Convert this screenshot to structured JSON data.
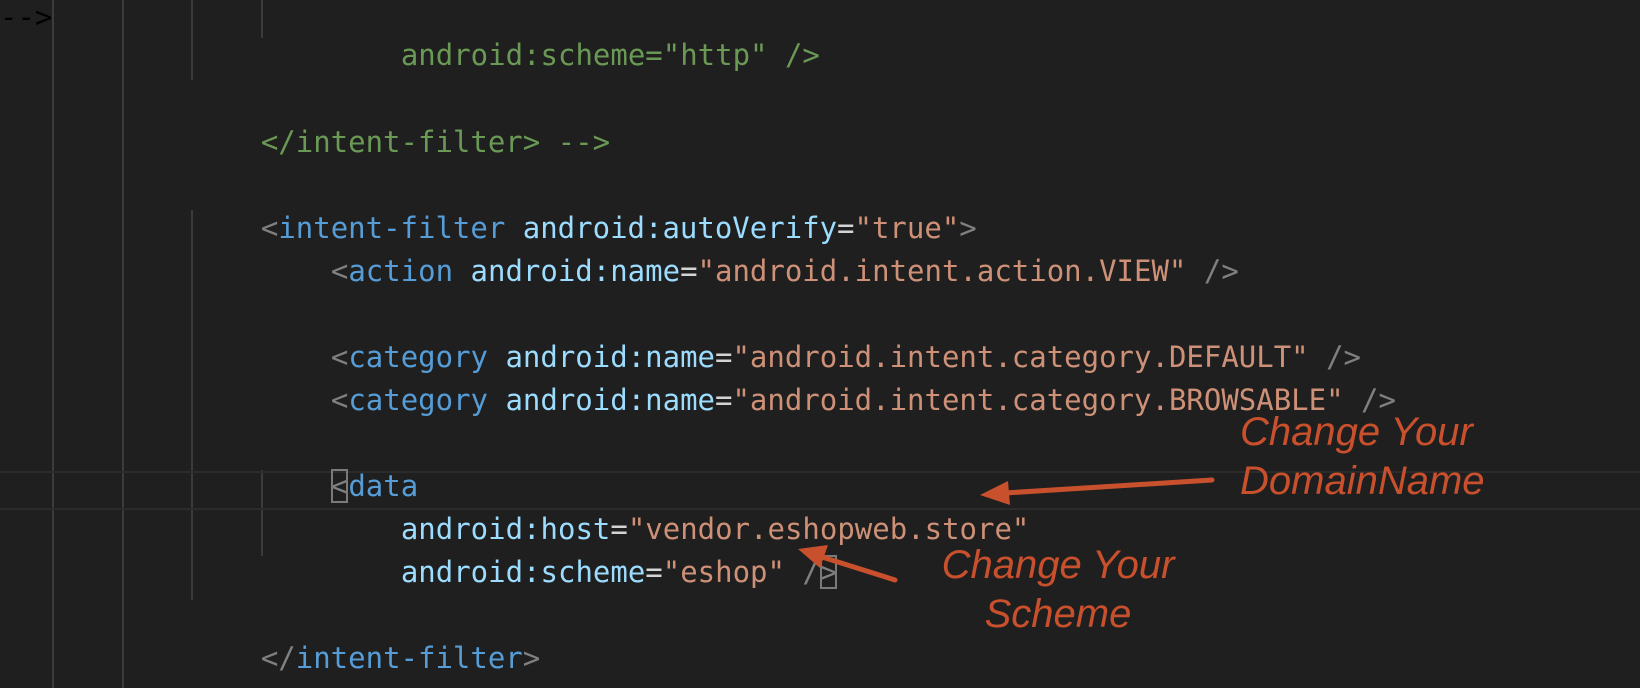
{
  "code": {
    "line_scheme_http": {
      "attr": "android:scheme",
      "eq": "=",
      "value": "\"http\"",
      "close": " />"
    },
    "line_close_comment": {
      "text": "</intent-filter> -->"
    },
    "line_open_filter": {
      "open": "<",
      "tag": "intent-filter",
      "attr": "android:autoVerify",
      "eq": "=",
      "value": "\"true\"",
      "close": ">"
    },
    "line_action": {
      "open": "<",
      "tag": "action",
      "attr": "android:name",
      "eq": "=",
      "value": "\"android.intent.action.VIEW\"",
      "close": " />"
    },
    "line_category_default": {
      "open": "<",
      "tag": "category",
      "attr": "android:name",
      "eq": "=",
      "value": "\"android.intent.category.DEFAULT\"",
      "close": " />"
    },
    "line_category_browsable": {
      "open": "<",
      "tag": "category",
      "attr": "android:name",
      "eq": "=",
      "value": "\"android.intent.category.BROWSABLE\"",
      "close": " />"
    },
    "line_data_open": {
      "open": "<",
      "tag": "data"
    },
    "line_host": {
      "attr": "android:host",
      "eq": "=",
      "value": "\"vendor.eshopweb.store\""
    },
    "line_scheme_eshop": {
      "attr": "android:scheme",
      "eq": "=",
      "value": "\"eshop\"",
      "close_slash": " /",
      "close_bracket": ">"
    },
    "line_close_filter": {
      "open": "</",
      "tag": "intent-filter",
      "close": ">"
    }
  },
  "annotations": {
    "domain": {
      "line1": "Change Your",
      "line2": "DomainName"
    },
    "scheme": {
      "line1": "Change Your",
      "line2": "Scheme"
    }
  },
  "colors": {
    "background": "#1f1f1f",
    "tag": "#569cd6",
    "attribute": "#9cdcfe",
    "string": "#ce9178",
    "comment": "#6a9955",
    "punctuation": "#808080",
    "annotation": "#c9502c"
  }
}
